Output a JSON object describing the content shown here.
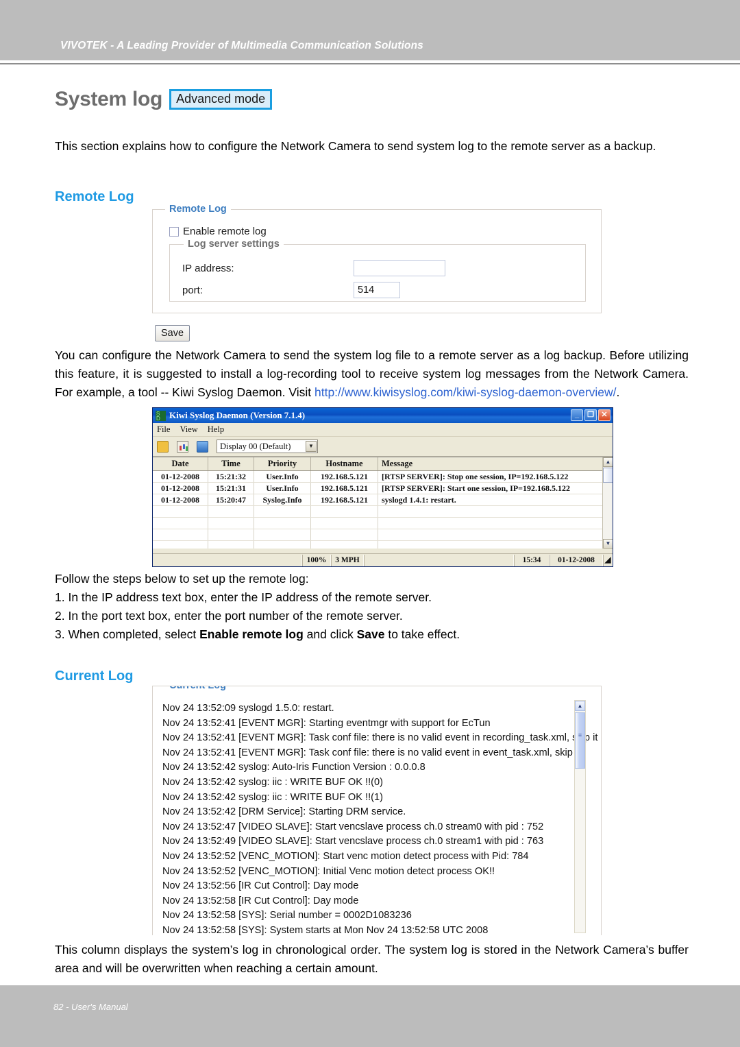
{
  "header": {
    "title": "VIVOTEK - A Leading Provider of Multimedia Communication Solutions"
  },
  "page": {
    "title": "System log",
    "mode_badge": "Advanced mode",
    "intro": "This section explains how to configure the Network Camera to send system log to the remote server as a backup."
  },
  "remote_log": {
    "heading": "Remote Log",
    "panel_legend": "Remote Log",
    "enable_checkbox_label": "Enable remote log",
    "enable_checked": false,
    "inner_legend": "Log server settings",
    "ip_label": "IP address:",
    "ip_value": "",
    "ip_placeholder": "",
    "port_label": "port:",
    "port_value": "514",
    "save_label": "Save",
    "description_pre_link": "You can configure the Network Camera to send the system log file to a remote server as a log backup. Before utilizing this feature, it is suggested to install a log-recording tool to receive system log messages from the Network Camera. For example, a tool -- Kiwi Syslog Daemon. Visit ",
    "description_link": "http://www.kiwisyslog.com/kiwi-syslog-daemon-overview/",
    "description_post_link": ".",
    "steps_intro": "Follow the steps below to set up the remote log:",
    "steps": [
      "1. In the IP address text box, enter the IP address of the remote server.",
      "2. In the port text box, enter the port number of the remote server."
    ],
    "step3_a": "3. When completed, select ",
    "step3_bold1": "Enable remote log",
    "step3_b": " and click ",
    "step3_bold2": "Save",
    "step3_c": " to take effect."
  },
  "kiwi_window": {
    "title": "Kiwi Syslog Daemon (Version 7.1.4)",
    "app_icon": "kiwi-app-icon",
    "menus": [
      "File",
      "View",
      "Help"
    ],
    "toolbar_icons": [
      "lock-icon",
      "chart-icon",
      "globe-icon"
    ],
    "display_select_value": "Display 00 (Default)",
    "columns": [
      "Date",
      "Time",
      "Priority",
      "Hostname",
      "Message"
    ],
    "rows": [
      {
        "date": "01-12-2008",
        "time": "15:21:32",
        "priority": "User.Info",
        "hostname": "192.168.5.121",
        "message": "[RTSP SERVER]: Stop one session, IP=192.168.5.122"
      },
      {
        "date": "01-12-2008",
        "time": "15:21:31",
        "priority": "User.Info",
        "hostname": "192.168.5.121",
        "message": "[RTSP SERVER]: Start one session, IP=192.168.5.122"
      },
      {
        "date": "01-12-2008",
        "time": "15:20:47",
        "priority": "Syslog.Info",
        "hostname": "192.168.5.121",
        "message": "syslogd 1.4.1: restart."
      }
    ],
    "status_bar": {
      "percent": "100%",
      "rate": "3 MPH",
      "middle": "",
      "time": "15:34",
      "date": "01-12-2008"
    },
    "window_buttons": [
      "minimize-button",
      "maximize-button",
      "close-button"
    ]
  },
  "current_log": {
    "heading": "Current Log",
    "panel_legend": "Current Log",
    "lines": [
      "Nov 24 13:52:09 syslogd 1.5.0: restart.",
      "Nov 24 13:52:41 [EVENT MGR]: Starting eventmgr with support for EcTun",
      "Nov 24 13:52:41 [EVENT MGR]: Task conf file: there is no valid event in recording_task.xml, skip it",
      "Nov 24 13:52:41 [EVENT MGR]: Task conf file: there is no valid event in event_task.xml, skip it",
      "Nov 24 13:52:42 syslog: Auto-Iris Function Version : 0.0.0.8",
      "Nov 24 13:52:42 syslog: iic : WRITE BUF OK !!(0)",
      "Nov 24 13:52:42 syslog: iic : WRITE BUF OK !!(1)",
      "Nov 24 13:52:42 [DRM Service]: Starting DRM service.",
      "Nov 24 13:52:47 [VIDEO SLAVE]: Start vencslave process ch.0 stream0 with pid : 752",
      "Nov 24 13:52:49 [VIDEO SLAVE]: Start vencslave process ch.0 stream1 with pid : 763",
      "Nov 24 13:52:52 [VENC_MOTION]: Start venc motion detect process with Pid: 784",
      "Nov 24 13:52:52 [VENC_MOTION]: Initial Venc motion detect process OK!!",
      "Nov 24 13:52:56 [IR Cut Control]: Day mode",
      "Nov 24 13:52:58 [IR Cut Control]: Day mode",
      "Nov 24 13:52:58 [SYS]: Serial number = 0002D1083236",
      "Nov 24 13:52:58 [SYS]: System starts at Mon Nov 24 13:52:58 UTC 2008"
    ],
    "description": "This column displays the system’s log in chronological order. The system log is stored in the Network Camera’s buffer area and will be overwritten when reaching a certain amount."
  },
  "footer": {
    "text": "82 - User's Manual"
  },
  "colors": {
    "header_band": "#bcbcbc",
    "section_heading": "#1f9ae3",
    "link": "#2d62d0",
    "badge_border": "#1a9ee0",
    "badge_fill": "#dbeefa",
    "title_grey": "#6d6d6d",
    "kiwi_titlebar": "#0a57c4"
  }
}
